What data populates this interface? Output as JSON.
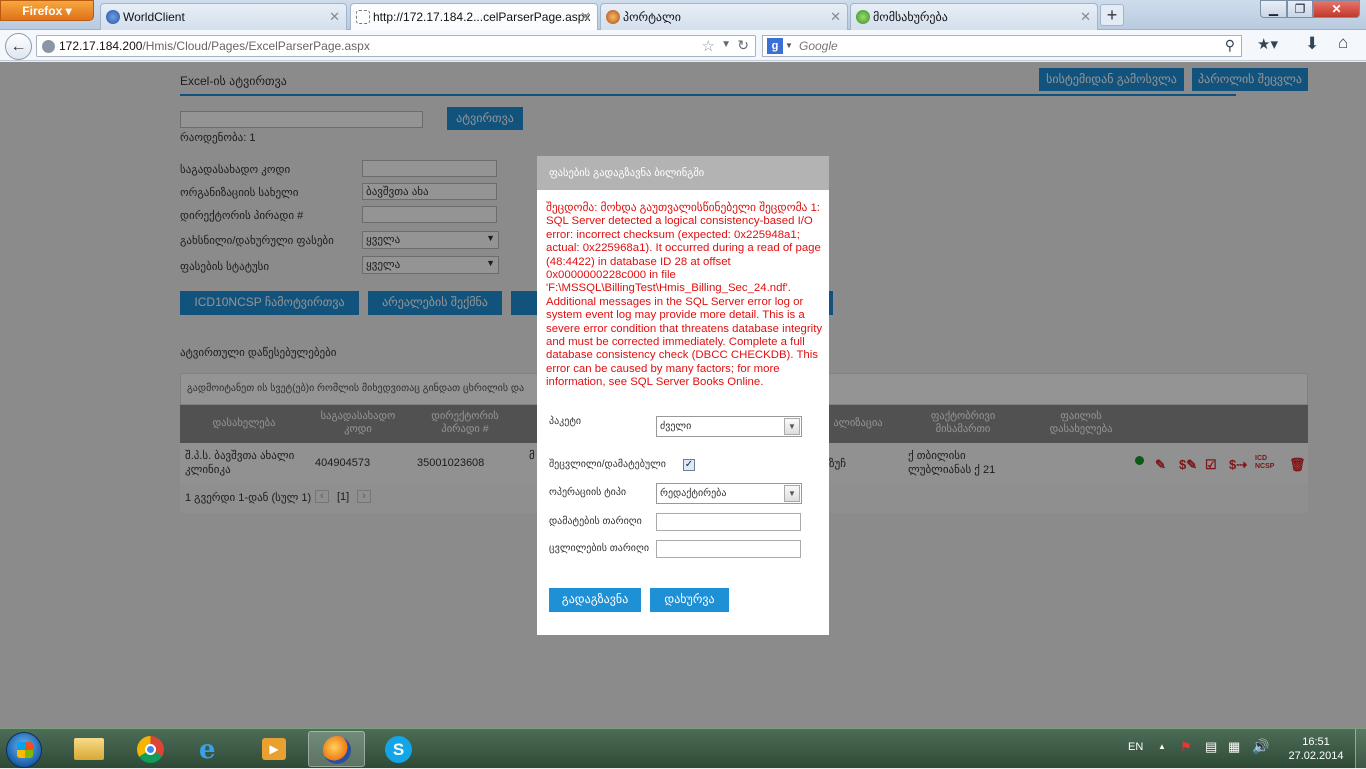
{
  "browser": {
    "menu_label": "Firefox",
    "tabs": [
      {
        "label": "WorldClient"
      },
      {
        "label": "http://172.17.184.2...celParserPage.aspx"
      },
      {
        "label": "პორტალი"
      },
      {
        "label": "მომსახურება"
      }
    ],
    "url_host": "172.17.184.200",
    "url_path": "/Hmis/Cloud/Pages/ExcelParserPage.aspx",
    "search_placeholder": "Google"
  },
  "page": {
    "title": "Excel-ის ატვირთვა",
    "logout_button": "სისტემიდან გამოსვლა",
    "change_password_button": "პაროლის შეცვლა",
    "upload_button": "ატვირთვა",
    "count_label": "რაოდენობა: 1",
    "filters": [
      {
        "label": "საგადასახადო კოდი",
        "value": ""
      },
      {
        "label": "ორგანიზაციის სახელი",
        "value": "ბავშვთა ახა"
      },
      {
        "label": "დირექტორის პირადი #",
        "value": ""
      },
      {
        "label": "გახსნილი/დახურული ფასები",
        "value": "ყველა"
      },
      {
        "label": "ფასების სტატუსი",
        "value": "ყველა"
      }
    ],
    "btn_icd": "ICD10NCSP ჩამოტვირთვა",
    "btn_register": "არეალების შექმნა",
    "uploaded_section": "ატვირთული დაწესებულებები",
    "info_text": "გადმოიტანეთ ის სვეტ(ებ)ი რომლის მიხედვითაც გინდათ ცხრილის და",
    "columns": {
      "c1": "დასახელება",
      "c2a": "საგადასახადო",
      "c2b": "კოდი",
      "c3a": "დირექტორის",
      "c3b": "პირადი #",
      "c4": "ალიზაცია",
      "c5a": "ფაქტობრივი",
      "c5b": "მისამართი",
      "c6a": "ფაილის",
      "c6b": "დასახელება"
    },
    "row": {
      "name_a": "შ.პ.ს. ბავშვთა ახალი",
      "name_b": "კლინიკა",
      "tax_code": "404904573",
      "director_id": "35001023608",
      "cell4_a": "მ",
      "cell5": "ზუჩ",
      "address_a": "ქ თბილისი",
      "address_b": "ლუბლიანას ქ 21"
    },
    "pager": {
      "text": "1 გვერდი 1-დან (სულ 1)",
      "prev": "‹",
      "current": "[1]",
      "next": "›"
    },
    "row_actions": [
      "status-dot-icon",
      "edit-icon",
      "price-icon",
      "checklist-icon",
      "transfer-icon",
      "icd-ncsp-icon",
      "delete-icon"
    ],
    "icd_icon_text_a": "ICD",
    "icd_icon_text_b": "NCSP"
  },
  "modal": {
    "title": "ფასების გადაგზავნა ბილინგში",
    "error": "შეცდომა: მოხდა გაუთვალისწინებელი შეცდომა 1: SQL Server detected a logical consistency-based I/O error: incorrect checksum (expected: 0x225948a1; actual: 0x225968a1). It occurred during a read of page (48:4422) in database ID 28 at offset 0x0000000228c000 in file 'F:\\MSSQL\\BillingTest\\Hmis_Billing_Sec_24.ndf'. Additional messages in the SQL Server error log or system event log may provide more detail. This is a severe error condition that threatens database integrity and must be corrected immediately. Complete a full database consistency check (DBCC CHECKDB). This error can be caused by many factors; for more information, see SQL Server Books Online.",
    "packet_label": "პაკეტი",
    "packet_value": "ძველი",
    "changed_label": "შეცვლილი/დამატებული",
    "changed_checked": true,
    "optype_label": "ოპერაციის ტიპი",
    "optype_value": "რედაქტირება",
    "added_date_label": "დამატების თარიღი",
    "changed_date_label": "ცვლილების თარიღი",
    "send_button": "გადაგზავნა",
    "close_button": "დახურვა"
  },
  "taskbar": {
    "lang": "EN",
    "time": "16:51",
    "date": "27.02.2014"
  },
  "colors": {
    "accent": "#1e90d6",
    "error": "#e01010",
    "action_red": "#d9262c",
    "status_green": "#1a9a2a"
  }
}
